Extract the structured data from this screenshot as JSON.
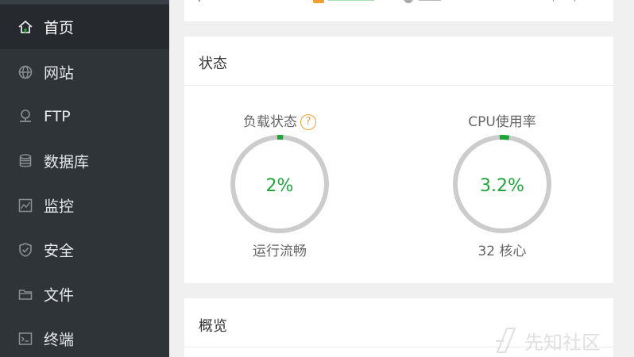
{
  "sidebar": {
    "items": [
      {
        "label": "首页",
        "icon": "home-icon",
        "active": true
      },
      {
        "label": "网站",
        "icon": "globe-icon",
        "active": false
      },
      {
        "label": "FTP",
        "icon": "ftp-icon",
        "active": false
      },
      {
        "label": "数据库",
        "icon": "database-icon",
        "active": false
      },
      {
        "label": "监控",
        "icon": "monitor-icon",
        "active": false
      },
      {
        "label": "安全",
        "icon": "shield-icon",
        "active": false
      },
      {
        "label": "文件",
        "icon": "folder-icon",
        "active": false
      },
      {
        "label": "终端",
        "icon": "terminal-icon",
        "active": false
      }
    ]
  },
  "status": {
    "title": "状态",
    "load": {
      "title": "负载状态",
      "help": "?",
      "value": "2%",
      "fraction": 0.02,
      "sub": "运行流畅"
    },
    "cpu": {
      "title": "CPU使用率",
      "value": "3.2%",
      "fraction": 0.032,
      "sub": "32 核心"
    }
  },
  "overview": {
    "title": "概览"
  },
  "colors": {
    "accent": "#20a53a",
    "sidebar_bg": "#2f3439",
    "gauge_track": "#cccccc",
    "help": "#f0a030"
  },
  "watermark": {
    "text": "先知社区"
  }
}
